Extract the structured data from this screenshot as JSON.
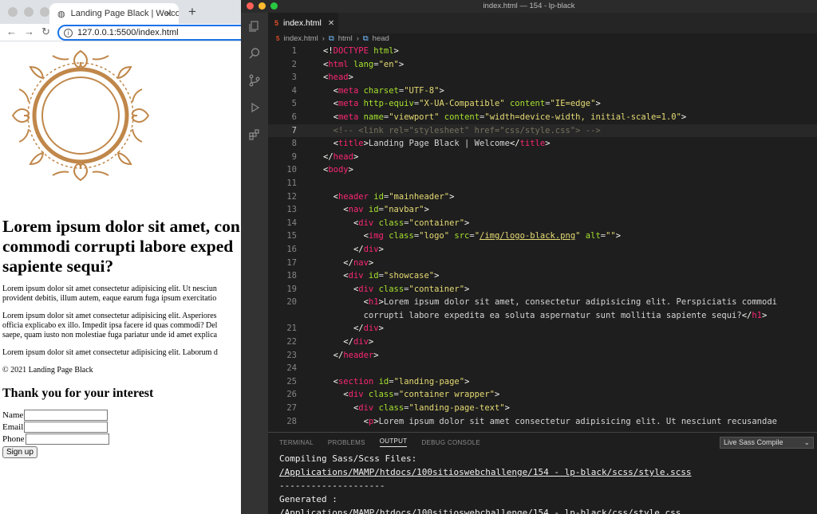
{
  "browser": {
    "tab_title": "Landing Page Black | Welcome",
    "url": "127.0.0.1:5500/index.html",
    "page": {
      "heading": "Lorem ipsum dolor sit amet, consectetur adipisicing elit. Perspiciatis commodi corrupti labore expedita ea soluta aspernatur sunt mollitia sapiente sequi?",
      "heading_lines": [
        "Lorem ipsum dolor sit amet, con",
        "commodi corrupti labore exped",
        "sapiente sequi?"
      ],
      "para1": [
        "Lorem ipsum dolor sit amet consectetur adipisicing elit. Ut nesciun",
        "provident debitis, illum autem, eaque earum fuga ipsum exercitatio"
      ],
      "para2": [
        "Lorem ipsum dolor sit amet consectetur adipisicing elit. Asperiores",
        "officia explicabo ex illo. Impedit ipsa facere id quas commodi? Del",
        "saepe, quam iusto non molestiae fuga pariatur unde id amet explica"
      ],
      "para3": "Lorem ipsum dolor sit amet consectetur adipisicing elit. Laborum d",
      "copyright": "© 2021 Landing Page Black",
      "form_title": "Thank you for your interest",
      "labels": {
        "name": "Name",
        "email": "Email",
        "phone": "Phone"
      },
      "submit": "Sign up"
    }
  },
  "editor": {
    "window_title": "index.html — 154 - lp-black",
    "tab": "index.html",
    "breadcrumbs": [
      "index.html",
      "html",
      "head"
    ],
    "code_lines": [
      {
        "n": "1",
        "html": "<span class=\"p\">&lt;!</span><span class=\"t\">DOCTYPE</span> <span class=\"a\">html</span><span class=\"p\">&gt;</span>"
      },
      {
        "n": "2",
        "html": "<span class=\"p\">&lt;</span><span class=\"t\">html</span> <span class=\"a\">lang</span>=<span class=\"v\">\"en\"</span><span class=\"p\">&gt;</span>"
      },
      {
        "n": "3",
        "html": "<span class=\"p\">&lt;</span><span class=\"t\">head</span><span class=\"p\">&gt;</span>"
      },
      {
        "n": "4",
        "html": "  <span class=\"p\">&lt;</span><span class=\"t\">meta</span> <span class=\"a\">charset</span>=<span class=\"v\">\"UTF-8\"</span><span class=\"p\">&gt;</span>"
      },
      {
        "n": "5",
        "html": "  <span class=\"p\">&lt;</span><span class=\"t\">meta</span> <span class=\"a\">http-equiv</span>=<span class=\"v\">\"X-UA-Compatible\"</span> <span class=\"a\">content</span>=<span class=\"v\">\"IE=edge\"</span><span class=\"p\">&gt;</span>"
      },
      {
        "n": "6",
        "html": "  <span class=\"p\">&lt;</span><span class=\"t\">meta</span> <span class=\"a\">name</span>=<span class=\"v\">\"viewport\"</span> <span class=\"a\">content</span>=<span class=\"v\">\"width=device-width, initial-scale=1.0\"</span><span class=\"p\">&gt;</span>"
      },
      {
        "n": "7",
        "html": "  <span class=\"c\">&lt;!-- &lt;link rel=\"stylesheet\" href=\"css/style.css\"&gt; --&gt;</span>",
        "active": true
      },
      {
        "n": "8",
        "html": "  <span class=\"p\">&lt;</span><span class=\"t\">title</span><span class=\"p\">&gt;</span>Landing Page Black | Welcome<span class=\"p\">&lt;/</span><span class=\"t\">title</span><span class=\"p\">&gt;</span>"
      },
      {
        "n": "9",
        "html": "<span class=\"p\">&lt;/</span><span class=\"t\">head</span><span class=\"p\">&gt;</span>"
      },
      {
        "n": "10",
        "html": "<span class=\"p\">&lt;</span><span class=\"t\">body</span><span class=\"p\">&gt;</span>"
      },
      {
        "n": "11",
        "html": ""
      },
      {
        "n": "12",
        "html": "  <span class=\"p\">&lt;</span><span class=\"t\">header</span> <span class=\"a\">id</span>=<span class=\"v\">\"mainheader\"</span><span class=\"p\">&gt;</span>"
      },
      {
        "n": "13",
        "html": "    <span class=\"p\">&lt;</span><span class=\"t\">nav</span> <span class=\"a\">id</span>=<span class=\"v\">\"navbar\"</span><span class=\"p\">&gt;</span>"
      },
      {
        "n": "14",
        "html": "      <span class=\"p\">&lt;</span><span class=\"t\">div</span> <span class=\"a\">class</span>=<span class=\"v\">\"container\"</span><span class=\"p\">&gt;</span>"
      },
      {
        "n": "15",
        "html": "        <span class=\"p\">&lt;</span><span class=\"t\">img</span> <span class=\"a\">class</span>=<span class=\"v\">\"logo\"</span> <span class=\"a\">src</span>=<span class=\"v\">\"<u>/img/logo-black.png</u>\"</span> <span class=\"a\">alt</span>=<span class=\"v\">\"\"</span><span class=\"p\">&gt;</span>"
      },
      {
        "n": "16",
        "html": "      <span class=\"p\">&lt;/</span><span class=\"t\">div</span><span class=\"p\">&gt;</span>"
      },
      {
        "n": "17",
        "html": "    <span class=\"p\">&lt;/</span><span class=\"t\">nav</span><span class=\"p\">&gt;</span>"
      },
      {
        "n": "18",
        "html": "    <span class=\"p\">&lt;</span><span class=\"t\">div</span> <span class=\"a\">id</span>=<span class=\"v\">\"showcase\"</span><span class=\"p\">&gt;</span>"
      },
      {
        "n": "19",
        "html": "      <span class=\"p\">&lt;</span><span class=\"t\">div</span> <span class=\"a\">class</span>=<span class=\"v\">\"container\"</span><span class=\"p\">&gt;</span>"
      },
      {
        "n": "20",
        "html": "        <span class=\"p\">&lt;</span><span class=\"t\">h1</span><span class=\"p\">&gt;</span>Lorem ipsum dolor sit amet, consectetur adipisicing elit. Perspiciatis commodi"
      },
      {
        "n": "",
        "html": "        corrupti labore expedita ea soluta aspernatur sunt mollitia sapiente sequi?<span class=\"p\">&lt;/</span><span class=\"t\">h1</span><span class=\"p\">&gt;</span>"
      },
      {
        "n": "21",
        "html": "      <span class=\"p\">&lt;/</span><span class=\"t\">div</span><span class=\"p\">&gt;</span>"
      },
      {
        "n": "22",
        "html": "    <span class=\"p\">&lt;/</span><span class=\"t\">div</span><span class=\"p\">&gt;</span>"
      },
      {
        "n": "23",
        "html": "  <span class=\"p\">&lt;/</span><span class=\"t\">header</span><span class=\"p\">&gt;</span>"
      },
      {
        "n": "24",
        "html": ""
      },
      {
        "n": "25",
        "html": "  <span class=\"p\">&lt;</span><span class=\"t\">section</span> <span class=\"a\">id</span>=<span class=\"v\">\"landing-page\"</span><span class=\"p\">&gt;</span>"
      },
      {
        "n": "26",
        "html": "    <span class=\"p\">&lt;</span><span class=\"t\">div</span> <span class=\"a\">class</span>=<span class=\"v\">\"container wrapper\"</span><span class=\"p\">&gt;</span>"
      },
      {
        "n": "27",
        "html": "      <span class=\"p\">&lt;</span><span class=\"t\">div</span> <span class=\"a\">class</span>=<span class=\"v\">\"landing-page-text\"</span><span class=\"p\">&gt;</span>"
      },
      {
        "n": "28",
        "html": "        <span class=\"p\">&lt;</span><span class=\"t\">p</span><span class=\"p\">&gt;</span>Lorem ipsum dolor sit amet consectetur adipisicing elit. Ut nesciunt recusandae"
      }
    ],
    "panel": {
      "tabs": [
        "TERMINAL",
        "PROBLEMS",
        "OUTPUT",
        "DEBUG CONSOLE"
      ],
      "active_tab": "OUTPUT",
      "select": "Live Sass Compile",
      "output_lines": [
        "Compiling Sass/Scss Files:",
        "/Applications/MAMP/htdocs/100sitioswebchallenge/154 - lp-black/scss/style.scss",
        "--------------------",
        "Generated :",
        "/Applications/MAMP/htdocs/100sitioswebchallenge/154 - lp-black/css/style.css"
      ]
    }
  },
  "colors": {
    "logo_gold": "#c0874a",
    "accent_blue": "#1a73e8",
    "editor_bg": "#1e1e1e"
  }
}
